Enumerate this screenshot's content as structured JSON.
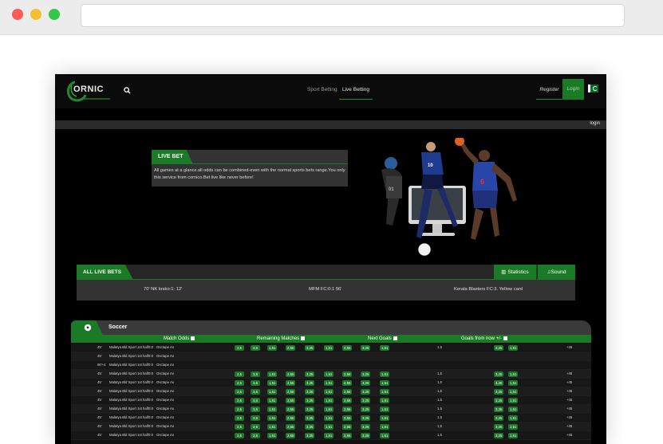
{
  "colors": {
    "accent": "#1a7a25",
    "background": "#000000",
    "panel": "#333333"
  },
  "header": {
    "logo_text": "ORNIC",
    "nav": [
      "Sport Betting",
      "Live Betting"
    ],
    "register": "Register",
    "login": "Login"
  },
  "strip": {
    "login": "login"
  },
  "live_bet": {
    "title": "LIVE BET",
    "description": "All games at a glance.all odds can be combined-even with the normal sports bets range.You only this service from cornico.Bet live like never before!"
  },
  "all_live_bets": {
    "title": "ALL LIVE BETS",
    "statistics": "Statistics",
    "sound": "Sound",
    "ticker": [
      "70' NK krsko:1: 12'",
      "MFM FC:0:1 56'",
      "Kerala Blasters FC:3. Yellow card"
    ]
  },
  "soccer": {
    "title": "Soccer",
    "columns": [
      "Match Odds",
      "Remaining Matches",
      "Next Goals",
      "Goals from now +/-"
    ],
    "rows": [
      {
        "min": "45'",
        "league": "Malatya Bld Sport 1st half",
        "score": "0:0",
        "team": "Osctape As",
        "odds": [
          "2,5",
          "3,5",
          "1,51",
          "2,55",
          "3,25",
          "1,51",
          "2,55",
          "3,25",
          "1,51"
        ],
        "next": "1,5",
        "g1": "3,25",
        "g2": "1,51",
        "more": "+45"
      },
      {
        "min": "45'",
        "league": "Malatya Bld Sport 1st half",
        "score": "0:0",
        "team": "Osctape As",
        "odds": [],
        "next": "",
        "g1": "",
        "g2": "",
        "more": ""
      },
      {
        "min": "90'+4",
        "league": "Malatya Bld Sport 1st half",
        "score": "0:0",
        "team": "Osctape As",
        "odds": [],
        "next": "",
        "g1": "",
        "g2": "",
        "more": ""
      },
      {
        "min": "45'",
        "league": "Malatya Bld Sport 1st half",
        "score": "0:0",
        "team": "Osctape As",
        "odds": [
          "2,5",
          "3,5",
          "1,51",
          "2,55",
          "3,25",
          "1,51",
          "2,55",
          "3,25",
          "1,51"
        ],
        "next": "1,5",
        "g1": "3,25",
        "g2": "1,51",
        "more": "+45"
      },
      {
        "min": "45'",
        "league": "Malatya Bld Sport 1st half",
        "score": "0:0",
        "team": "Osctape As",
        "odds": [
          "2,5",
          "3,5",
          "1,51",
          "2,55",
          "3,25",
          "1,51",
          "2,55",
          "3,25",
          "1,51"
        ],
        "next": "1,5",
        "g1": "3,25",
        "g2": "1,51",
        "more": "+45"
      },
      {
        "min": "45'",
        "league": "Malatya Bld Sport 1st half",
        "score": "0:0",
        "team": "Osctape As",
        "odds": [
          "2,5",
          "3,5",
          "1,51",
          "2,55",
          "3,25",
          "1,51",
          "2,55",
          "3,25",
          "1,51"
        ],
        "next": "1,5",
        "g1": "3,25",
        "g2": "1,51",
        "more": "+45"
      },
      {
        "min": "45'",
        "league": "Malatya Bld Sport 1st half",
        "score": "0:0",
        "team": "Osctape As",
        "odds": [
          "2,5",
          "3,5",
          "1,51",
          "2,55",
          "3,25",
          "1,51",
          "2,55",
          "3,25",
          "1,51"
        ],
        "next": "1,5",
        "g1": "3,25",
        "g2": "1,51",
        "more": "+45"
      },
      {
        "min": "45'",
        "league": "Malatya Bld Sport 1st half",
        "score": "0:0",
        "team": "Osctape As",
        "odds": [
          "2,5",
          "3,5",
          "1,51",
          "2,55",
          "3,25",
          "1,51",
          "2,55",
          "3,25",
          "1,51"
        ],
        "next": "1,5",
        "g1": "3,25",
        "g2": "1,51",
        "more": "+45"
      },
      {
        "min": "45'",
        "league": "Malatya Bld Sport 1st half",
        "score": "0:0",
        "team": "Osctape As",
        "odds": [
          "2,5",
          "3,5",
          "1,51",
          "2,55",
          "3,25",
          "1,51",
          "2,55",
          "3,25",
          "1,51"
        ],
        "next": "1,5",
        "g1": "3,25",
        "g2": "1,51",
        "more": "+45"
      },
      {
        "min": "45'",
        "league": "Malatya Bld Sport 1st half",
        "score": "0:0",
        "team": "Osctape As",
        "odds": [
          "2,5",
          "3,5",
          "1,51",
          "2,55",
          "3,25",
          "1,51",
          "2,55",
          "3,25",
          "1,51"
        ],
        "next": "1,5",
        "g1": "3,25",
        "g2": "1,51",
        "more": "+45"
      },
      {
        "min": "45'",
        "league": "Malatya Bld Sport 1st half",
        "score": "0:0",
        "team": "Osctape As",
        "odds": [
          "2,5",
          "3,5",
          "1,51",
          "2,55",
          "3,25",
          "1,51",
          "2,55",
          "3,25",
          "1,51"
        ],
        "next": "1,5",
        "g1": "3,25",
        "g2": "1,51",
        "more": "+45"
      }
    ]
  }
}
